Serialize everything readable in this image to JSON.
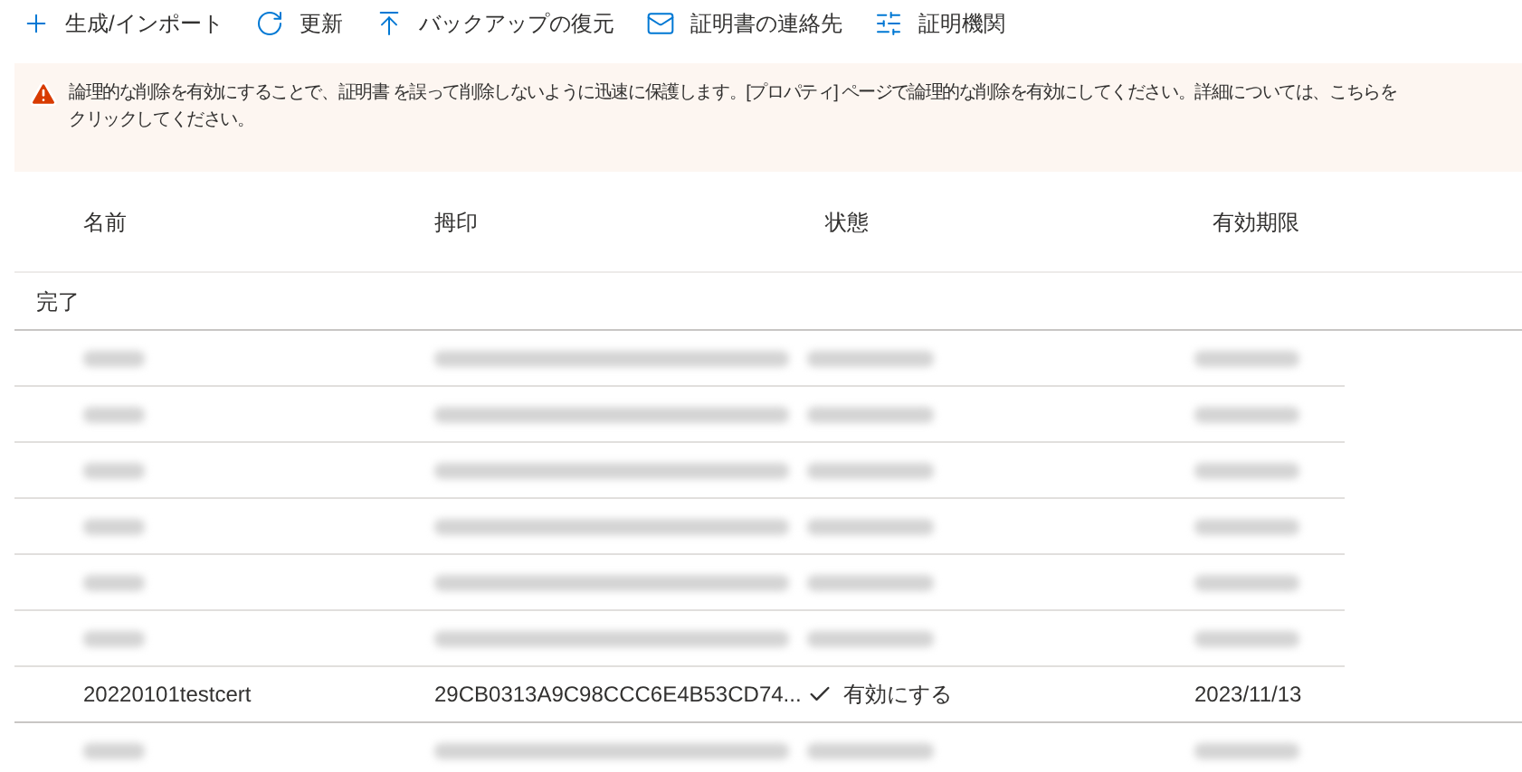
{
  "toolbar": [
    {
      "kind": "add",
      "label": "生成/インポート"
    },
    {
      "kind": "refresh",
      "label": "更新"
    },
    {
      "kind": "restore",
      "label": "バックアップの復元"
    },
    {
      "kind": "mail",
      "label": "証明書の連絡先"
    },
    {
      "kind": "settings",
      "label": "証明機関"
    }
  ],
  "banner": {
    "kind": "warning",
    "lines": [
      "論理的な削除を有効にすることで、証明書 を誤って削除しないように迅速に保護します。[プロパティ] ページで論理的な削除を有効にしてください。詳細については、こちらを",
      "クリックしてください。"
    ]
  },
  "table": {
    "columns": [
      "名前",
      "拇印",
      "状態",
      "有効期限"
    ],
    "group": "完了",
    "rows": [
      {
        "kind": "redacted"
      },
      {
        "kind": "redacted"
      },
      {
        "kind": "redacted"
      },
      {
        "kind": "redacted"
      },
      {
        "kind": "redacted"
      },
      {
        "kind": "redacted"
      },
      {
        "kind": "cert",
        "name": "20220101testcert",
        "thumbprint": "29CB0313A9C98CCC6E4B53CD74...",
        "status": "有効にする",
        "expires": "2023/11/13"
      },
      {
        "kind": "redacted"
      }
    ]
  }
}
